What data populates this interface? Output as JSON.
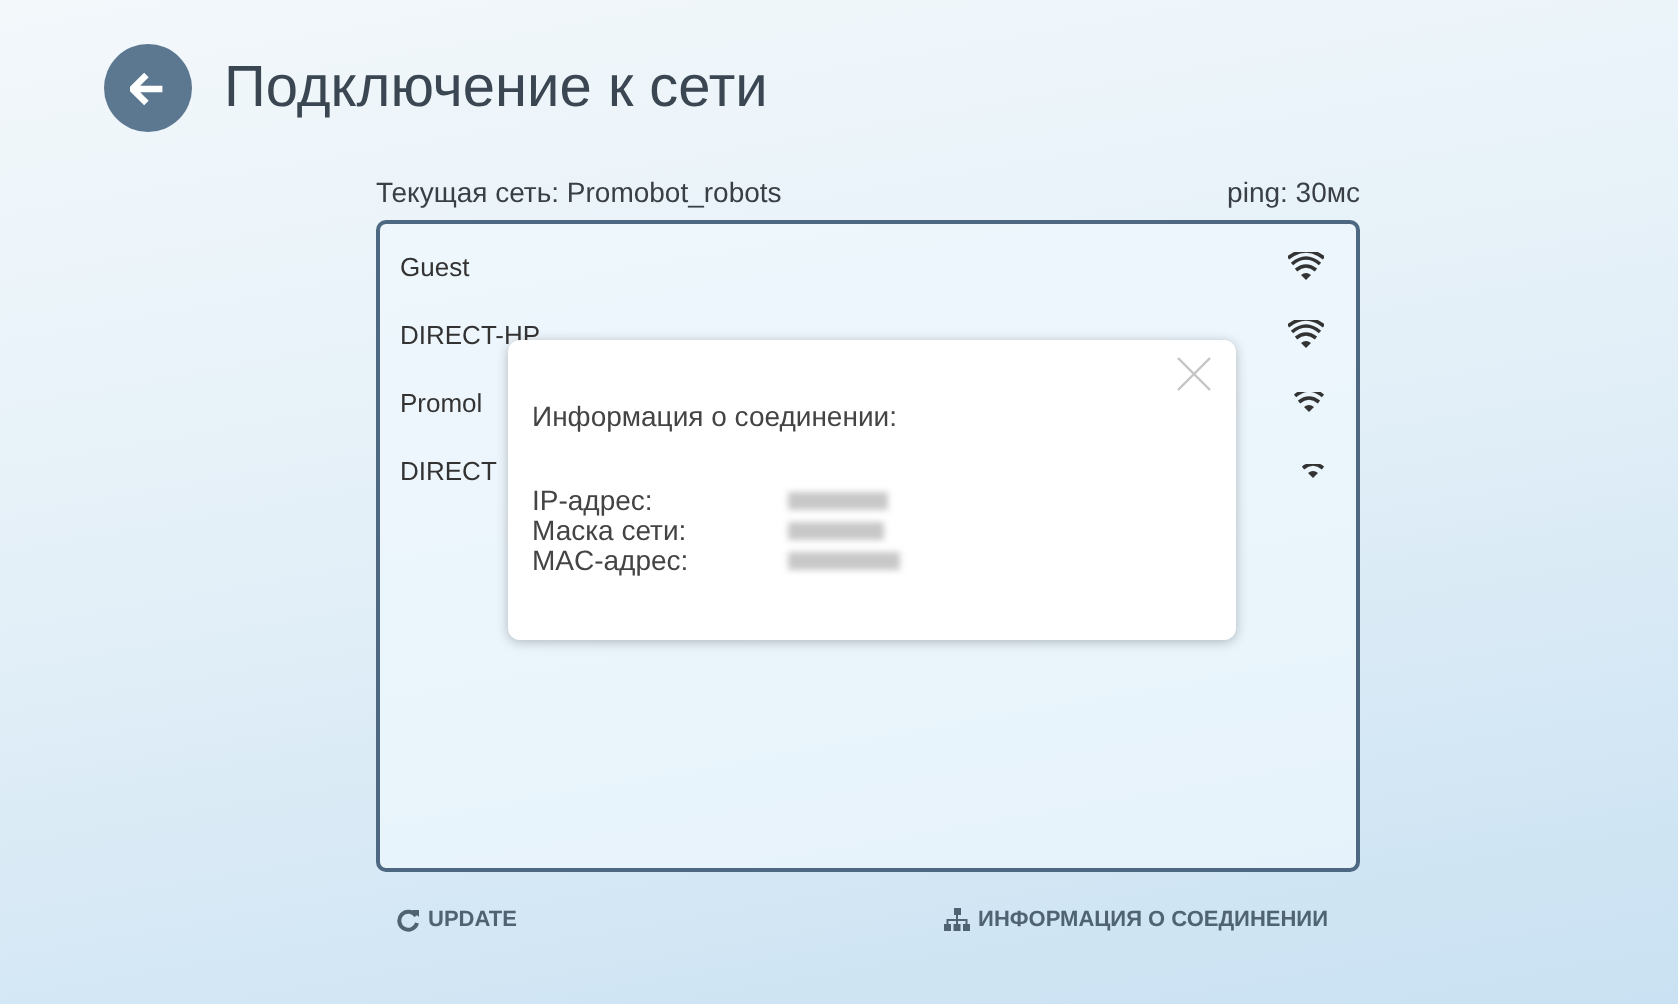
{
  "header": {
    "title": "Подключение к сети"
  },
  "status": {
    "current_network": "Текущая сеть: Promobot_robots",
    "ping": "ping: 30мс"
  },
  "networks": [
    {
      "name": "Guest",
      "kind": "full"
    },
    {
      "name": "DIRECT-HP",
      "kind": "full"
    },
    {
      "name": "Promol",
      "kind": "medium"
    },
    {
      "name": "DIRECT",
      "kind": "low"
    }
  ],
  "dialog": {
    "title": "Информация о соединении:",
    "fields": [
      {
        "label": "IP-адрес:"
      },
      {
        "label": "Маска сети:"
      },
      {
        "label": "MAC-адрес:"
      }
    ]
  },
  "actions": [
    {
      "label": "UPDATE",
      "kind": "refresh"
    },
    {
      "label": "ИНФОРМАЦИЯ О СОЕДИНЕНИИ",
      "kind": "network"
    }
  ]
}
